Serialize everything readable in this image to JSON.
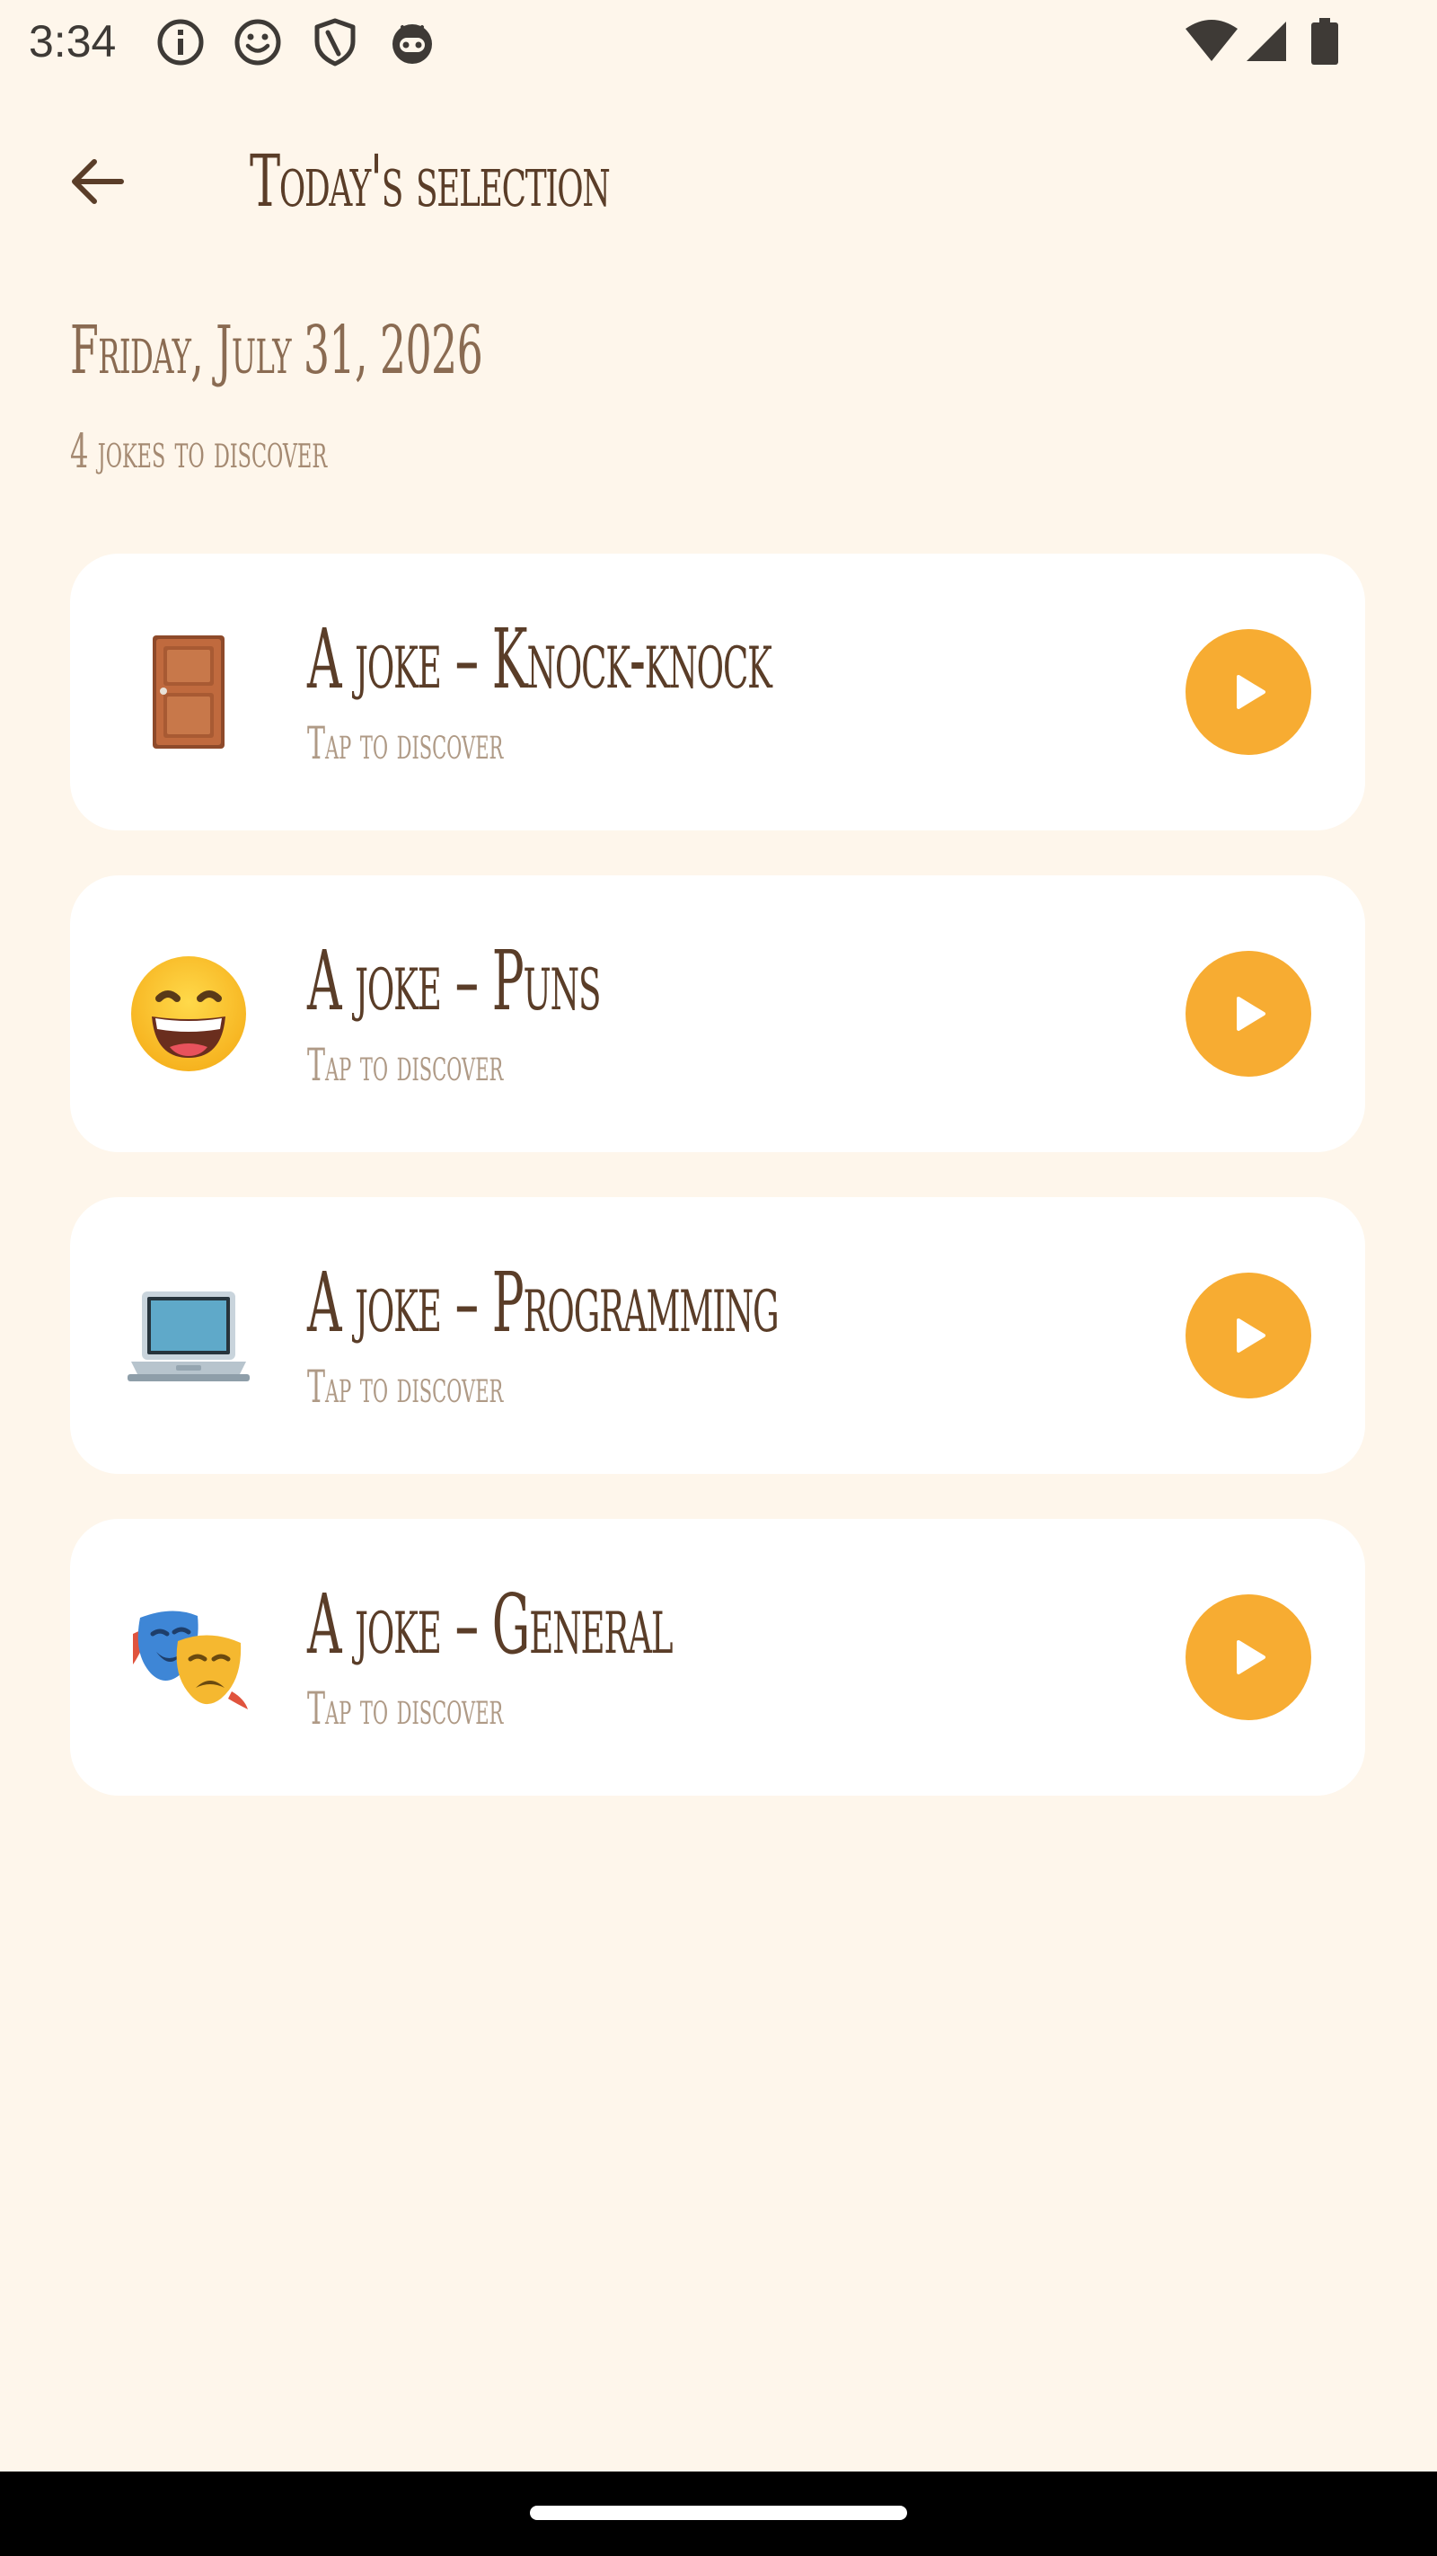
{
  "status_bar": {
    "time": "3:34",
    "left_icons": [
      "info-icon",
      "smiley-icon",
      "shield-icon",
      "robot-icon"
    ],
    "right_icons": [
      "wifi-icon",
      "cellular-icon",
      "battery-icon"
    ]
  },
  "app_bar": {
    "title": "Today's selection",
    "back_icon": "arrow-back-icon"
  },
  "header": {
    "date": "Friday, July 31, 2026",
    "count": "4 jokes to discover"
  },
  "jokes": [
    {
      "emoji": "door",
      "title": "A joke – Knock-knock",
      "subtitle": "Tap to discover"
    },
    {
      "emoji": "grinning-face",
      "title": "A joke – Puns",
      "subtitle": "Tap to discover"
    },
    {
      "emoji": "laptop",
      "title": "A joke – Programming",
      "subtitle": "Tap to discover"
    },
    {
      "emoji": "theater-masks",
      "title": "A joke – General",
      "subtitle": "Tap to discover"
    }
  ],
  "colors": {
    "background": "#FEF6EB",
    "card": "#FFFFFF",
    "accent": "#F7AC32",
    "title_text": "#5A3D28",
    "subtitle_text": "#AF9A86"
  }
}
